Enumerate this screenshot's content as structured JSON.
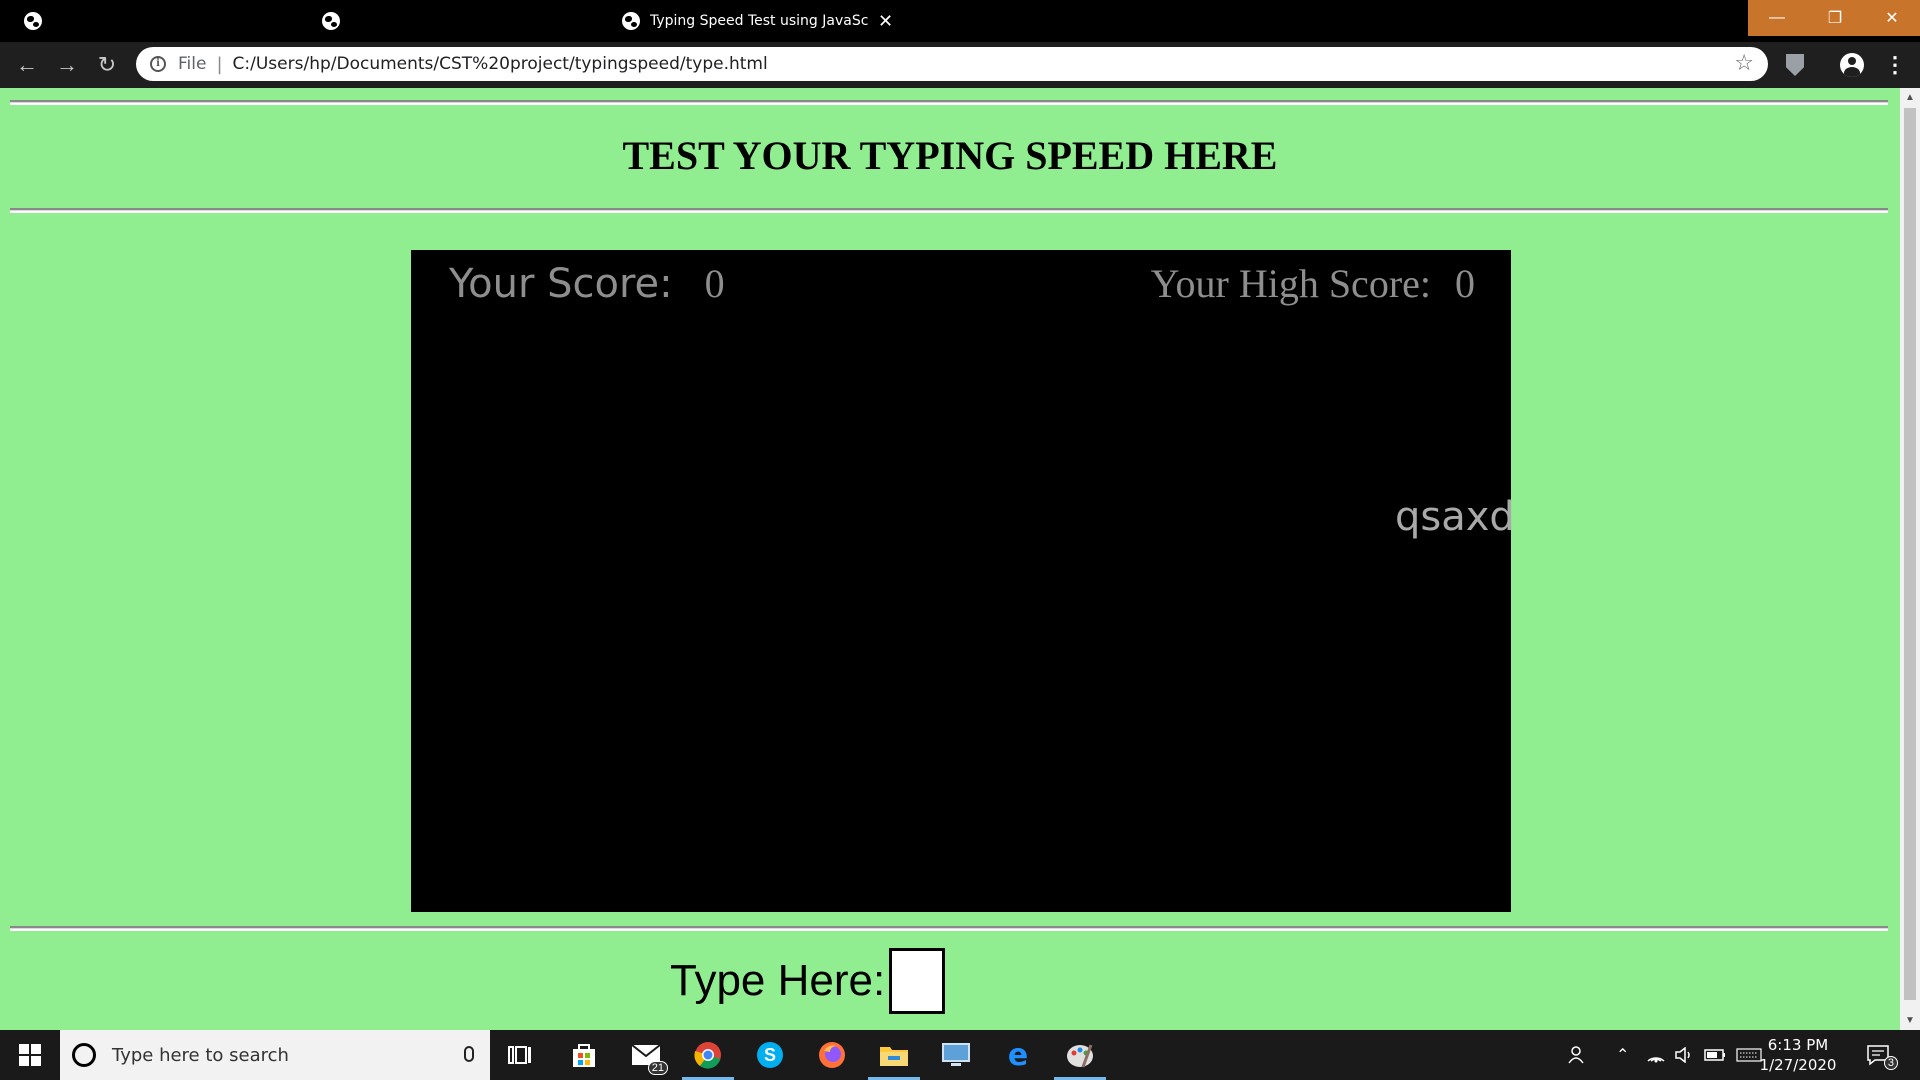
{
  "browser": {
    "tabs": [
      {
        "title": ""
      },
      {
        "title": ""
      },
      {
        "title": "Typing Speed Test using JavaScript"
      }
    ],
    "address": {
      "scheme_label": "File",
      "url": "C:/Users/hp/Documents/CST%20project/typingspeed/type.html"
    },
    "window_controls": {
      "minimize": "—",
      "restore": "❐",
      "close": "✕"
    },
    "accent_color": "#c8742a"
  },
  "page": {
    "background_color": "#90ee90",
    "heading": "TEST YOUR TYPING SPEED HERE",
    "game": {
      "score_label": "Your Score:",
      "score_value": "0",
      "high_score_label": "Your High Score:",
      "high_score_value": "0",
      "falling_word": "qsaxd"
    },
    "input": {
      "label": "Type Here:",
      "value": ""
    }
  },
  "taskbar": {
    "search_placeholder": "Type here to search",
    "mail_badge": "21",
    "clock_time": "6:13 PM",
    "clock_date": "1/27/2020",
    "notification_badge": "3",
    "pinned_icons": [
      "task-view-icon",
      "store-icon",
      "mail-icon",
      "chrome-icon",
      "skype-icon",
      "firefox-icon",
      "file-explorer-icon",
      "remote-desktop-icon",
      "edge-icon",
      "paint-icon"
    ]
  }
}
